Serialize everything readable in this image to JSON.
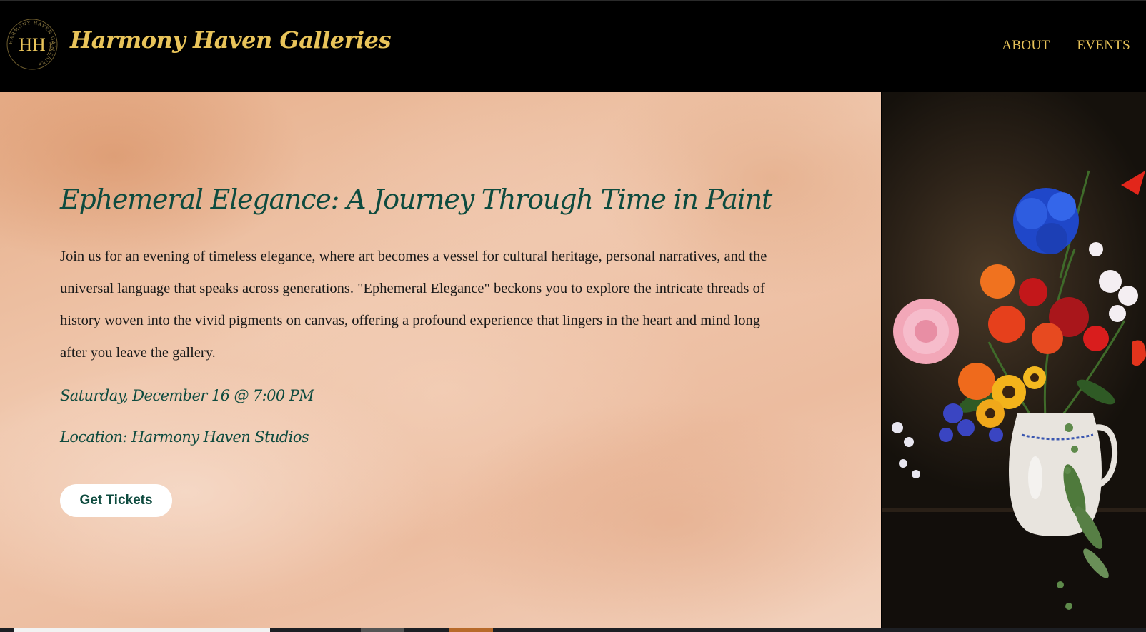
{
  "header": {
    "logo_monogram": "HH",
    "logo_ring_text": "HARMONY HAVEN GALLERIES",
    "brand_name": "Harmony Haven Galleries",
    "nav": [
      {
        "label": "ABOUT"
      },
      {
        "label": "EVENTS"
      }
    ]
  },
  "hero": {
    "title": "Ephemeral Elegance: A Journey Through Time in Paint",
    "description": "Join us for an evening of timeless elegance, where art becomes a vessel for cultural heritage, personal narratives, and the universal language that speaks across generations. \"Ephemeral Elegance\" beckons you to explore the intricate threads of history woven into the vivid pigments on canvas, offering a profound experience that lingers in the heart and mind long after you leave the gallery.",
    "date": "Saturday, December 16 @ 7:00 PM",
    "location": "Location: Harmony Haven Studios",
    "cta_label": "Get Tickets"
  },
  "colors": {
    "brand_gold": "#e9c45a",
    "heading_green": "#0e4b3f",
    "header_bg": "#000000",
    "button_bg": "#ffffff"
  }
}
